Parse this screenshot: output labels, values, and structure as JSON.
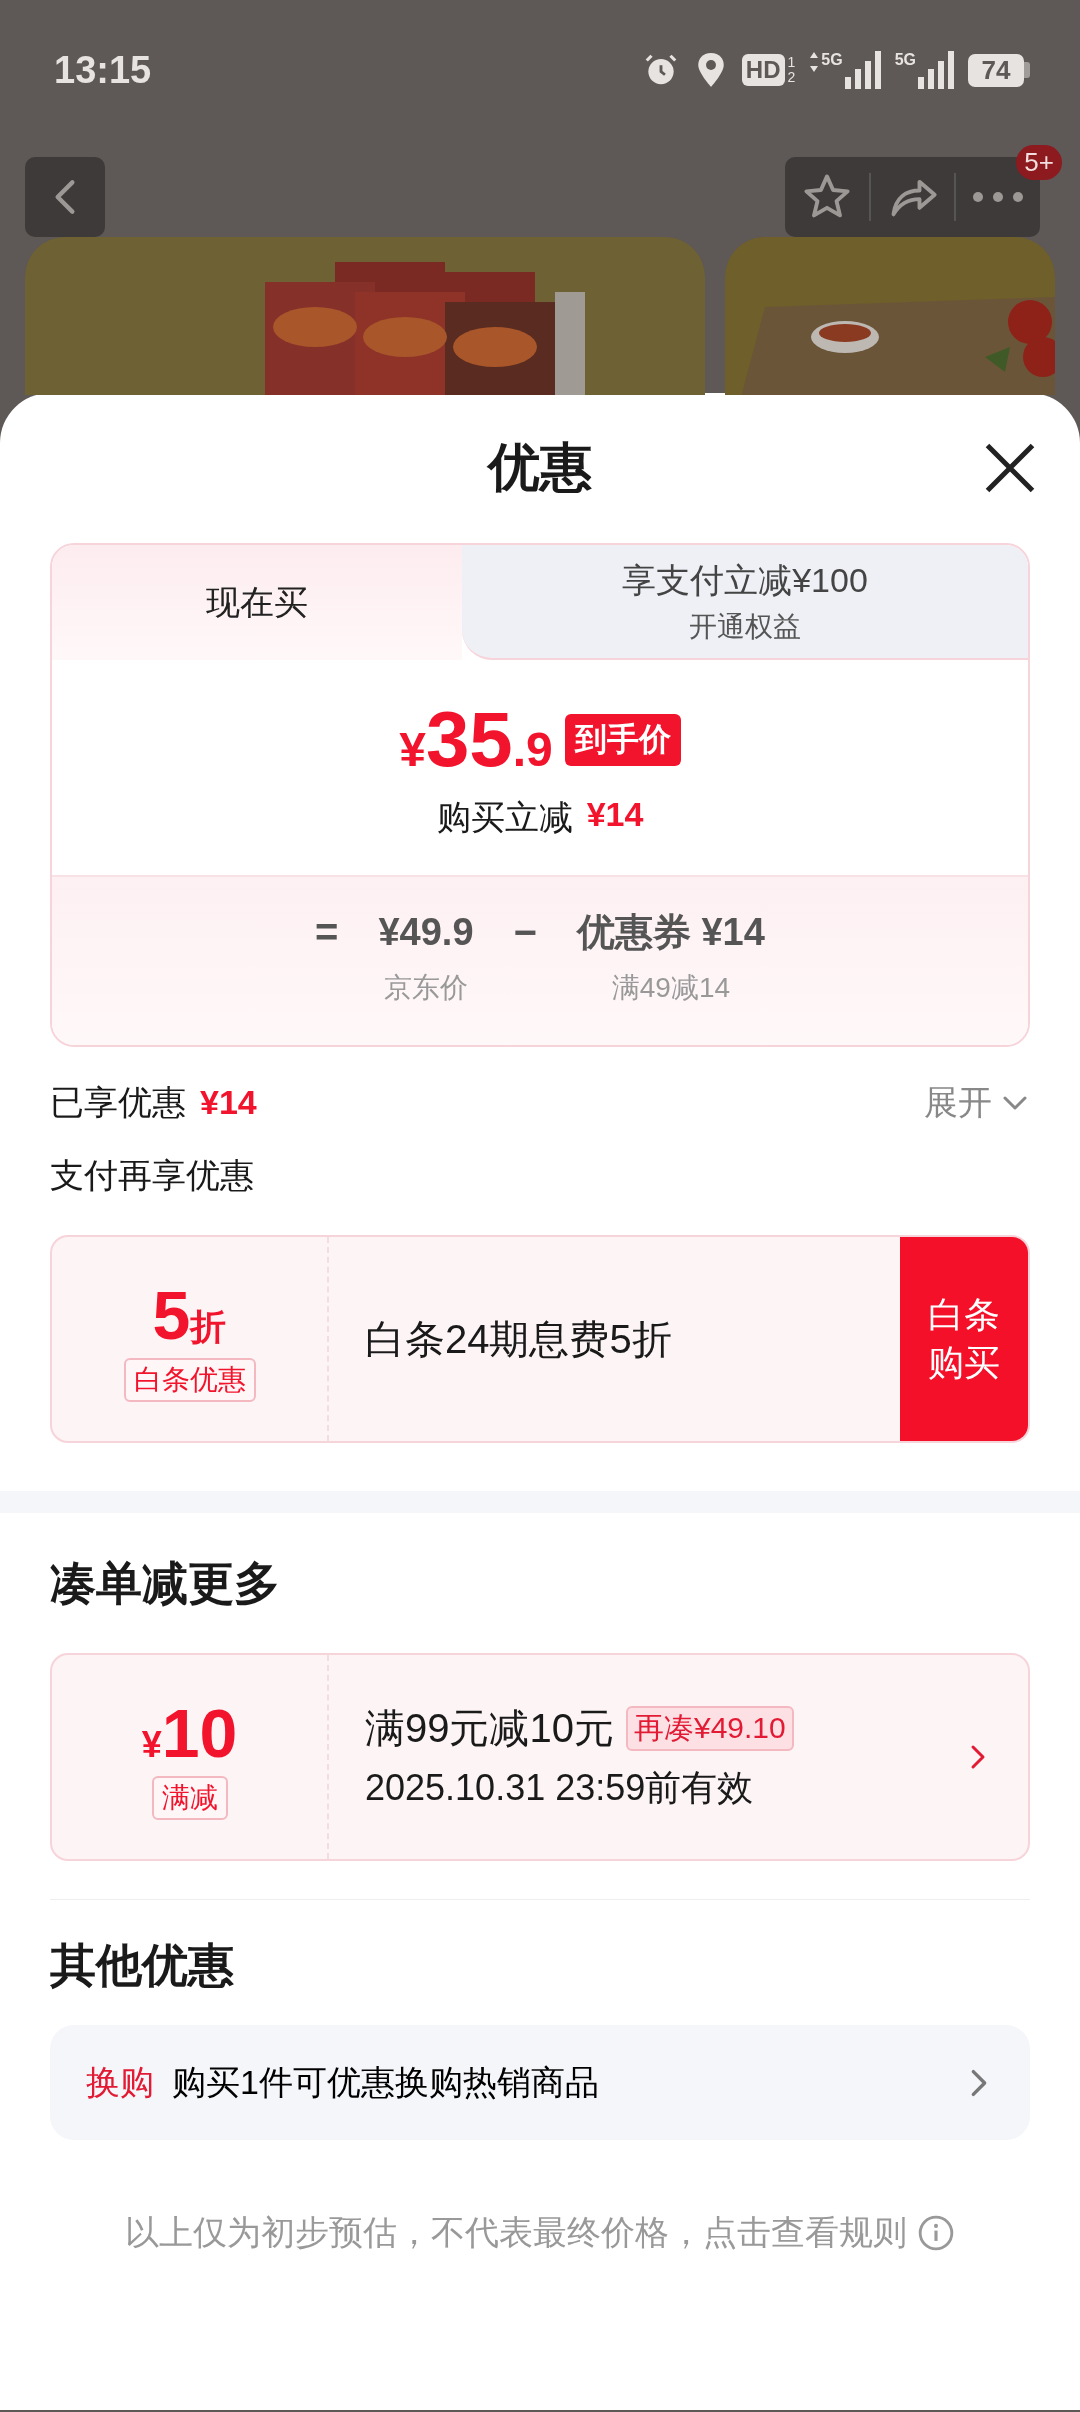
{
  "status_bar": {
    "time": "13:15",
    "hd": "HD",
    "sim_numbers": [
      "1",
      "2"
    ],
    "networks": [
      {
        "label": "5G",
        "data_activity": true
      },
      {
        "label": "5G",
        "data_activity": false
      }
    ],
    "battery": "74"
  },
  "header": {
    "badge": "5+"
  },
  "sheet": {
    "title": "优惠"
  },
  "tabs": [
    {
      "label": "现在买",
      "selected": true
    },
    {
      "label": "享支付立减¥100",
      "sublabel": "开通权益",
      "selected": false
    }
  ],
  "price": {
    "currency": "¥",
    "integer": "35",
    "decimal": ".9",
    "tag": "到手价",
    "saving_label": "购买立减",
    "saving_amount": "¥14"
  },
  "breakdown": [
    {
      "kind": "operator",
      "text": "="
    },
    {
      "kind": "term",
      "value": "¥49.9",
      "caption": "京东价"
    },
    {
      "kind": "operator",
      "text": "−"
    },
    {
      "kind": "term",
      "value": "优惠券 ¥14",
      "caption": "满49减14"
    }
  ],
  "enjoyed": {
    "label": "已享优惠",
    "amount": "¥14",
    "toggle": "展开",
    "expanded": false
  },
  "pay_more": {
    "title": "支付再享优惠",
    "offer": {
      "value": "5",
      "unit": "折",
      "tag": "白条优惠",
      "text": "白条24期息费5折",
      "button": "白条购买"
    }
  },
  "bundle": {
    "title": "凑单减更多",
    "coupon": {
      "currency": "¥",
      "amount": "10",
      "tag": "满减",
      "condition": "满99元减10元",
      "badge": "再凑¥49.10",
      "validity": "2025.10.31 23:59前有效"
    }
  },
  "other": {
    "title": "其他优惠",
    "items": [
      {
        "tag": "换购",
        "text": "购买1件可优惠换购热销商品"
      }
    ]
  },
  "footer": {
    "note": "以上仅为初步预估，不代表最终价格，点击查看规则"
  }
}
